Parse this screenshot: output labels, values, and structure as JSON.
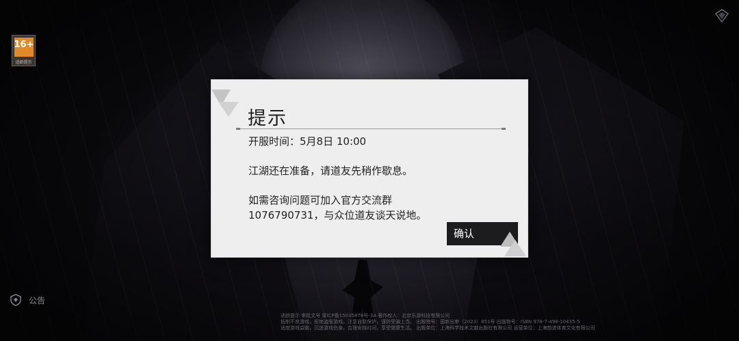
{
  "age_rating": {
    "number": "16+",
    "label": "适龄提示"
  },
  "dialog": {
    "title": "提示",
    "open_time": "开服时间：5月8日 10:00",
    "message": "江湖还在准备，请道友先稍作歇息。",
    "contact_line1": "如需咨询问题可加入官方交流群",
    "contact_line2": "1076790731，与众位道友谈天说地。",
    "confirm_label": "确认"
  },
  "notice": {
    "label": "公告"
  },
  "footer": {
    "line1": "适龄提示  审批文号  家ICP备15035878号-3A    著作权人：北京乐游科技有限公司",
    "line2": "抵制不良游戏，拒绝盗版游戏。注意自我保护，谨防受骗上当。  出版物号：国新出审〔2023〕851号  出版物号：ISBN 978-7-498-10435-5",
    "line3": "适度游戏益脑，沉迷游戏伤身。合理安排时间，享受健康生活。  出版单位：上海科学技术文献出版社有限公司  运营单位：上海韵迹体育文化有限公司"
  },
  "colors": {
    "dialog_bg": "#eeeeee",
    "button_bg": "#1c1c1f",
    "age_badge": "#e08a28"
  },
  "icons": {
    "corner": "emblem-icon",
    "notice": "shield-notice-icon"
  }
}
